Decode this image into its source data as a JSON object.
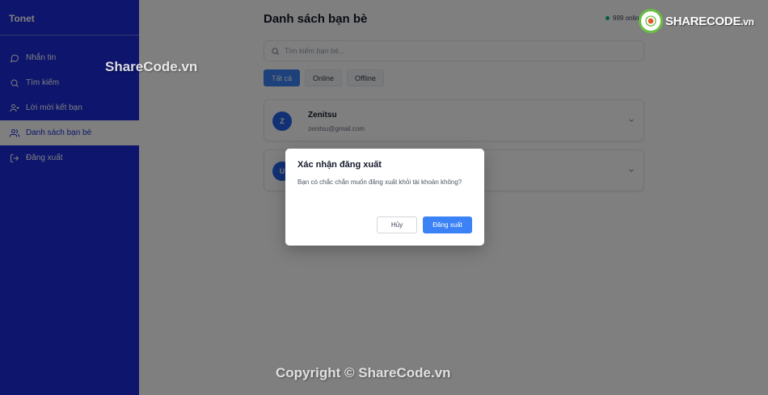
{
  "app": {
    "name": "Tonet"
  },
  "sidebar": {
    "items": [
      {
        "label": "Nhắn tin",
        "icon": "message-icon",
        "active": false
      },
      {
        "label": "Tìm kiếm",
        "icon": "search-icon",
        "active": false
      },
      {
        "label": "Lời mời kết bạn",
        "icon": "user-plus-icon",
        "active": false
      },
      {
        "label": "Danh sách bạn bè",
        "icon": "users-icon",
        "active": true
      },
      {
        "label": "Đăng xuất",
        "icon": "logout-icon",
        "active": false
      }
    ]
  },
  "main": {
    "title": "Danh sách bạn bè",
    "online_status": "999 online",
    "search": {
      "placeholder": "Tìm kiếm bạn bè...",
      "value": ""
    },
    "filters": [
      {
        "label": "Tất cả",
        "active": true
      },
      {
        "label": "Online",
        "active": false
      },
      {
        "label": "Offline",
        "active": false
      }
    ],
    "friends": [
      {
        "initial": "Z",
        "name": "Zenitsu",
        "email": "zenitsu@gmail.com"
      },
      {
        "initial": "U",
        "name": "",
        "email": ""
      }
    ]
  },
  "modal": {
    "title": "Xác nhận đăng xuất",
    "message": "Bạn có chắc chắn muốn đăng xuất khỏi tài khoản không?",
    "cancel_label": "Hủy",
    "confirm_label": "Đăng xuất"
  },
  "watermark": {
    "top": "ShareCode.vn",
    "bottom": "Copyright © ShareCode.vn",
    "logo_main": "SHARECODE",
    "logo_suffix": ".vn"
  },
  "colors": {
    "sidebar_bg": "#1a2bd9",
    "accent": "#3b82f6",
    "online": "#10b981"
  }
}
